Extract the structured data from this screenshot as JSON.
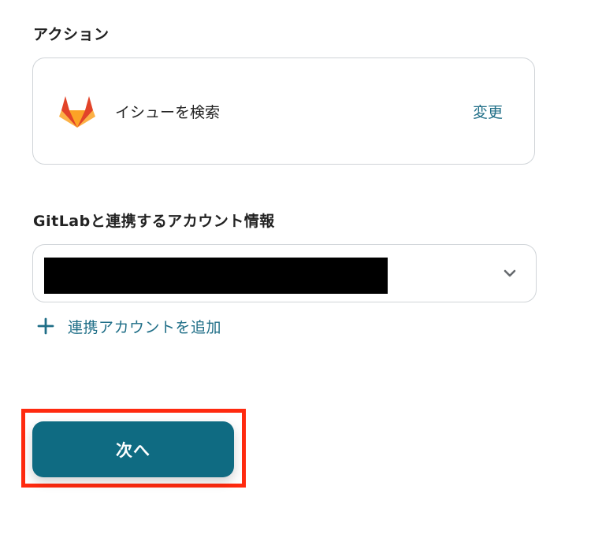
{
  "action_section": {
    "label": "アクション",
    "action_name": "イシューを検索",
    "change_label": "変更",
    "logo_icon": "gitlab-logo-icon"
  },
  "account_section": {
    "label": "GitLabと連携するアカウント情報",
    "selected_value": "",
    "chevron_icon": "chevron-down-icon",
    "add_account_label": "連携アカウントを追加",
    "add_icon": "plus-icon"
  },
  "footer": {
    "next_label": "次へ",
    "highlight_color": "#ff2a0f"
  },
  "colors": {
    "accent": "#1f6e87",
    "primary_button": "#0f6b82"
  }
}
